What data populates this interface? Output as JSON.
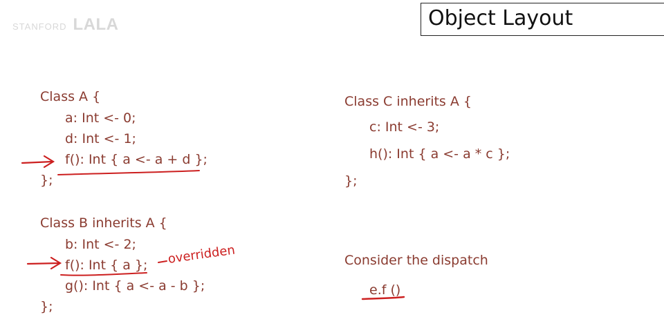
{
  "logo": {
    "small_text": "STANFORD",
    "big_text": "LALA"
  },
  "slide_title": "Object Layout",
  "class_a": {
    "lines": [
      "Class A {",
      "a: Int <- 0;",
      "d: Int <- 1;",
      "f(): Int { a <- a + d };",
      "};"
    ]
  },
  "class_b": {
    "lines": [
      "Class  B inherits A {",
      "b: Int <- 2;",
      "f(): Int { a };",
      "g(): Int { a <- a - b };",
      "};"
    ]
  },
  "class_c": {
    "lines": [
      "Class  C inherits A {",
      "c: Int <- 3;",
      "h(): Int { a <- a * c };",
      "};"
    ]
  },
  "dispatch": {
    "label": "Consider the dispatch",
    "expression": "e.f ()"
  },
  "annotations": {
    "overridden": "overridden",
    "ink_color": "#cc1f1f",
    "code_color": "#8a3b30"
  }
}
